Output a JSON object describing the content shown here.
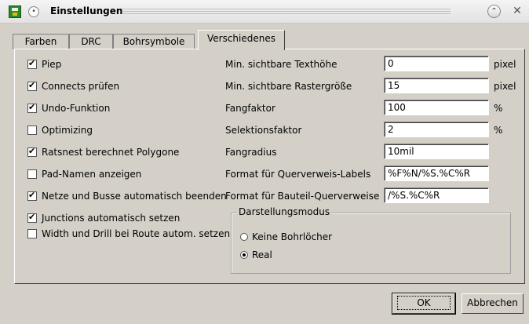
{
  "window": {
    "title": "Einstellungen"
  },
  "titlebar": {
    "shade_glyph": "•",
    "roll_glyph": "⌃",
    "close_glyph": "✕"
  },
  "tabs": [
    {
      "label": "Farben"
    },
    {
      "label": "DRC"
    },
    {
      "label": "Bohrsymbole"
    },
    {
      "label": "Verschiedenes",
      "active": true
    }
  ],
  "checkboxes": [
    {
      "label": "Piep",
      "checked": true
    },
    {
      "label": "Connects prüfen",
      "checked": true
    },
    {
      "label": "Undo-Funktion",
      "checked": true
    },
    {
      "label": "Optimizing",
      "checked": false
    },
    {
      "label": "Ratsnest berechnet Polygone",
      "checked": true
    },
    {
      "label": "Pad-Namen anzeigen",
      "checked": false
    },
    {
      "label": "Netze und Busse automatisch beenden",
      "checked": true
    },
    {
      "label": "Junctions automatisch setzen",
      "checked": true
    },
    {
      "label": "Width und Drill bei Route autom. setzen",
      "checked": false
    }
  ],
  "fields": [
    {
      "label": "Min. sichtbare Texthöhe",
      "value": "0",
      "unit": "pixel"
    },
    {
      "label": "Min. sichtbare Rastergröße",
      "value": "15",
      "unit": "pixel"
    },
    {
      "label": "Fangfaktor",
      "value": "100",
      "unit": "%"
    },
    {
      "label": "Selektionsfaktor",
      "value": "2",
      "unit": "%"
    },
    {
      "label": "Fangradius",
      "value": "10mil",
      "unit": ""
    },
    {
      "label": "Format für Querverweis-Labels",
      "value": "%F%N/%S.%C%R",
      "unit": ""
    },
    {
      "label": "Format für Bauteil-Querverweise",
      "value": "/%S.%C%R",
      "unit": ""
    }
  ],
  "display_mode": {
    "title": "Darstellungsmodus",
    "options": [
      {
        "label": "Keine Bohrlöcher",
        "selected": false
      },
      {
        "label": "Real",
        "selected": true
      }
    ]
  },
  "buttons": {
    "ok": "OK",
    "cancel": "Abbrechen"
  },
  "colors": {
    "dialog_bg": "#d4d0c8",
    "app_icon": "#2d8a2d"
  }
}
